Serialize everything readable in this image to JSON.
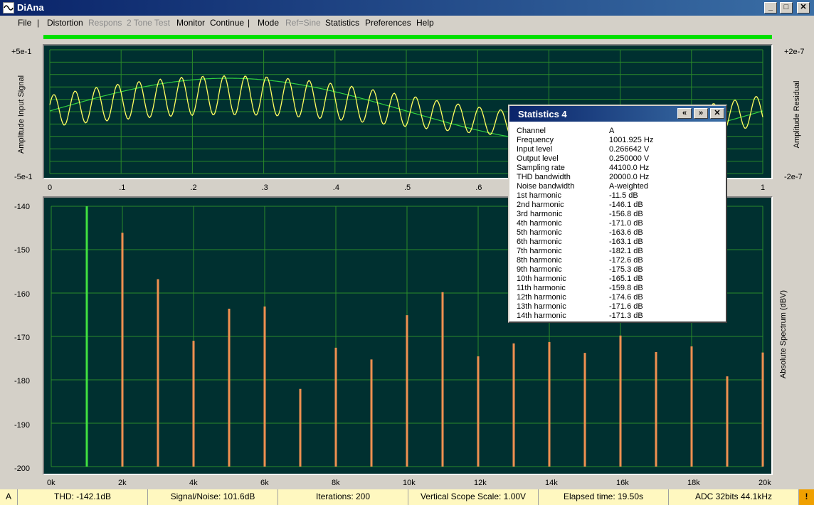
{
  "app": {
    "title": "DiAna"
  },
  "window_buttons": [
    "_",
    "□",
    "✕"
  ],
  "menu": [
    {
      "label": "File",
      "enabled": true
    },
    {
      "label": "|",
      "sep": true
    },
    {
      "label": "Distortion",
      "enabled": true
    },
    {
      "label": "Respons",
      "enabled": false
    },
    {
      "label": "2 Tone Test",
      "enabled": false
    },
    {
      "label": "Monitor",
      "enabled": true
    },
    {
      "label": "Continue",
      "enabled": true
    },
    {
      "label": "|",
      "sep": true
    },
    {
      "label": "Mode",
      "enabled": true
    },
    {
      "label": "Ref=Sine",
      "enabled": false
    },
    {
      "label": "Statistics",
      "enabled": true
    },
    {
      "label": "Preferences",
      "enabled": true
    },
    {
      "label": "Help",
      "enabled": true
    }
  ],
  "progress": 1.0,
  "scope": {
    "left_top": "+5e-1",
    "left_bottom": "-5e-1",
    "right_top": "+2e-7",
    "right_bottom": "-2e-7",
    "left_label": "Amplitude Input Signal",
    "right_label": "Amplitude Residual",
    "x_ticks": [
      "0",
      ".1",
      ".2",
      ".3",
      ".4",
      ".5",
      ".6",
      ".7",
      ".8",
      ".9",
      "1"
    ]
  },
  "spectrum": {
    "y_ticks": [
      "-140",
      "-150",
      "-160",
      "-170",
      "-180",
      "-190",
      "-200"
    ],
    "x_ticks": [
      "0k",
      "2k",
      "4k",
      "6k",
      "8k",
      "10k",
      "12k",
      "14k",
      "16k",
      "18k",
      "20k"
    ],
    "right_label": "Absolute Spectrum (dBV)"
  },
  "chart_data": [
    {
      "type": "line",
      "title": "",
      "xlabel": "",
      "ylabel": "Amplitude Input Signal",
      "xlim": [
        0,
        1
      ],
      "series": [
        {
          "name": "",
          "color": "#ffff60",
          "description_freq_cycles": 34
        },
        {
          "name": "",
          "color": "#30d040"
        }
      ]
    },
    {
      "type": "bar",
      "title": "",
      "ylabel": "Absolute Spectrum (dBV)",
      "xlim": [
        0,
        20000
      ],
      "ylim": [
        -200,
        -140
      ],
      "fundamental": {
        "x": 1000,
        "value": -140,
        "color": "#40e040"
      },
      "harmonics": {
        "color": "#f09050",
        "x": [
          2000,
          3000,
          4000,
          5000,
          6000,
          7000,
          8000,
          9000,
          10000,
          11000,
          12000,
          13000,
          14000,
          15000,
          16000,
          17000,
          18000,
          19000,
          20000
        ],
        "values": [
          -146.1,
          -156.8,
          -171.0,
          -163.6,
          -163.1,
          -182.1,
          -172.6,
          -175.3,
          -165.1,
          -159.8,
          -174.6,
          -171.6,
          -171.3,
          -173.8,
          -169.8,
          -173.6,
          -172.3,
          -179.2,
          -173.7
        ]
      }
    }
  ],
  "stats": {
    "title": "Statistics 4",
    "buttons": [
      "«",
      "»",
      "✕"
    ],
    "rows": [
      [
        "Channel",
        "A"
      ],
      [
        "Frequency",
        "1001.925 Hz"
      ],
      [
        "Input level",
        "0.266642 V"
      ],
      [
        "Output level",
        "0.250000 V"
      ],
      [
        "Sampling rate",
        "44100.0 Hz"
      ],
      [
        "THD bandwidth",
        "20000.0 Hz"
      ],
      [
        "Noise bandwidth",
        "A-weighted"
      ],
      [
        "1st harmonic",
        "-11.5 dB"
      ],
      [
        "2nd harmonic",
        "-146.1 dB"
      ],
      [
        "3rd harmonic",
        "-156.8 dB"
      ],
      [
        "4th harmonic",
        "-171.0 dB"
      ],
      [
        "5th harmonic",
        "-163.6 dB"
      ],
      [
        "6th harmonic",
        "-163.1 dB"
      ],
      [
        "7th harmonic",
        "-182.1 dB"
      ],
      [
        "8th harmonic",
        "-172.6 dB"
      ],
      [
        "9th harmonic",
        "-175.3 dB"
      ],
      [
        "10th harmonic",
        "-165.1 dB"
      ],
      [
        "11th harmonic",
        "-159.8 dB"
      ],
      [
        "12th harmonic",
        "-174.6 dB"
      ],
      [
        "13th harmonic",
        "-171.6 dB"
      ],
      [
        "14th harmonic",
        "-171.3 dB"
      ]
    ]
  },
  "status": {
    "channel": "A",
    "thd": "THD: -142.1dB",
    "snr": "Signal/Noise:  101.6dB",
    "iterations": "Iterations: 200",
    "scope_scale": "Vertical Scope Scale: 1.00V",
    "elapsed": "Elapsed time: 19.50s",
    "adc": "ADC 32bits 44.1kHz",
    "warn": "!"
  }
}
